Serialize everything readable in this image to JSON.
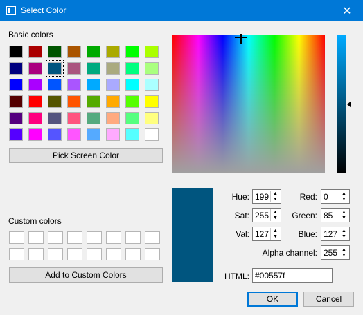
{
  "window": {
    "title": "Select Color",
    "close_glyph": "✕"
  },
  "basic_colors": {
    "label": "Basic colors",
    "selected": "#00557f",
    "rows": [
      [
        "#000000",
        "#aa0000",
        "#005500",
        "#aa5500",
        "#00aa00",
        "#aaaa00",
        "#00ff00",
        "#aaff00"
      ],
      [
        "#00007f",
        "#aa007f",
        "#00557f",
        "#aa557f",
        "#00aa7f",
        "#aaaa7f",
        "#00ff7f",
        "#aaff7f"
      ],
      [
        "#0000ff",
        "#aa00ff",
        "#0055ff",
        "#aa55ff",
        "#00aaff",
        "#aaaaff",
        "#00ffff",
        "#aaffff"
      ],
      [
        "#550000",
        "#ff0000",
        "#555500",
        "#ff5500",
        "#55aa00",
        "#ffaa00",
        "#55ff00",
        "#ffff00"
      ],
      [
        "#55007f",
        "#ff007f",
        "#55557f",
        "#ff557f",
        "#55aa7f",
        "#ffaa7f",
        "#55ff7f",
        "#ffff7f"
      ],
      [
        "#5500ff",
        "#ff00ff",
        "#5555ff",
        "#ff55ff",
        "#55aaff",
        "#ffaaff",
        "#55ffff",
        "#ffffff"
      ]
    ]
  },
  "pick_screen_color_label": "Pick Screen Color",
  "custom_colors": {
    "label": "Custom colors",
    "rows": 2,
    "cols": 8
  },
  "add_custom_label": "Add to Custom Colors",
  "current_color": "#00557f",
  "fields": {
    "hue": {
      "label": "Hue:",
      "value": "199"
    },
    "sat": {
      "label": "Sat:",
      "value": "255"
    },
    "val": {
      "label": "Val:",
      "value": "127"
    },
    "red": {
      "label": "Red:",
      "value": "0"
    },
    "green": {
      "label": "Green:",
      "value": "85"
    },
    "blue": {
      "label": "Blue:",
      "value": "127"
    },
    "alpha": {
      "label": "Alpha channel:",
      "value": "255"
    },
    "html": {
      "label": "HTML:",
      "value": "#00557f"
    }
  },
  "buttons": {
    "ok": "OK",
    "cancel": "Cancel"
  }
}
